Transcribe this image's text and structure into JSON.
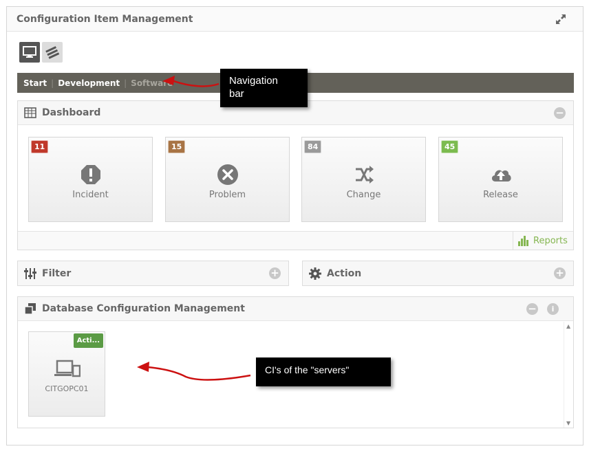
{
  "window": {
    "title": "Configuration Item Management"
  },
  "view_toggle": {
    "active": "desktop-icon",
    "inactive": "server-stack-icon"
  },
  "breadcrumb": {
    "items": [
      "Start",
      "Development",
      "Software"
    ]
  },
  "dashboard": {
    "title": "Dashboard",
    "tiles": [
      {
        "count": "11",
        "label": "Incident",
        "icon": "exclamation-circle-icon",
        "badge_color": "#c0392b"
      },
      {
        "count": "15",
        "label": "Problem",
        "icon": "times-circle-icon",
        "badge_color": "#a87445"
      },
      {
        "count": "84",
        "label": "Change",
        "icon": "shuffle-icon",
        "badge_color": "#9a9a9a"
      },
      {
        "count": "45",
        "label": "Release",
        "icon": "cloud-upload-icon",
        "badge_color": "#7cbb4f"
      }
    ],
    "reports_label": "Reports"
  },
  "filter": {
    "title": "Filter"
  },
  "action": {
    "title": "Action"
  },
  "dbcm": {
    "title": "Database Configuration Management",
    "ci": {
      "status": "Acti...",
      "name": "CITGOPC01",
      "status_color": "#5b9b45"
    }
  },
  "annotations": {
    "navigation": "Navigation bar",
    "navigation_line1": "Navigation",
    "navigation_line2": "bar",
    "servers": "CI's of the \"servers\""
  },
  "colors": {
    "navbar": "#636159",
    "arrow": "#cc1111",
    "reports": "#85b651"
  }
}
